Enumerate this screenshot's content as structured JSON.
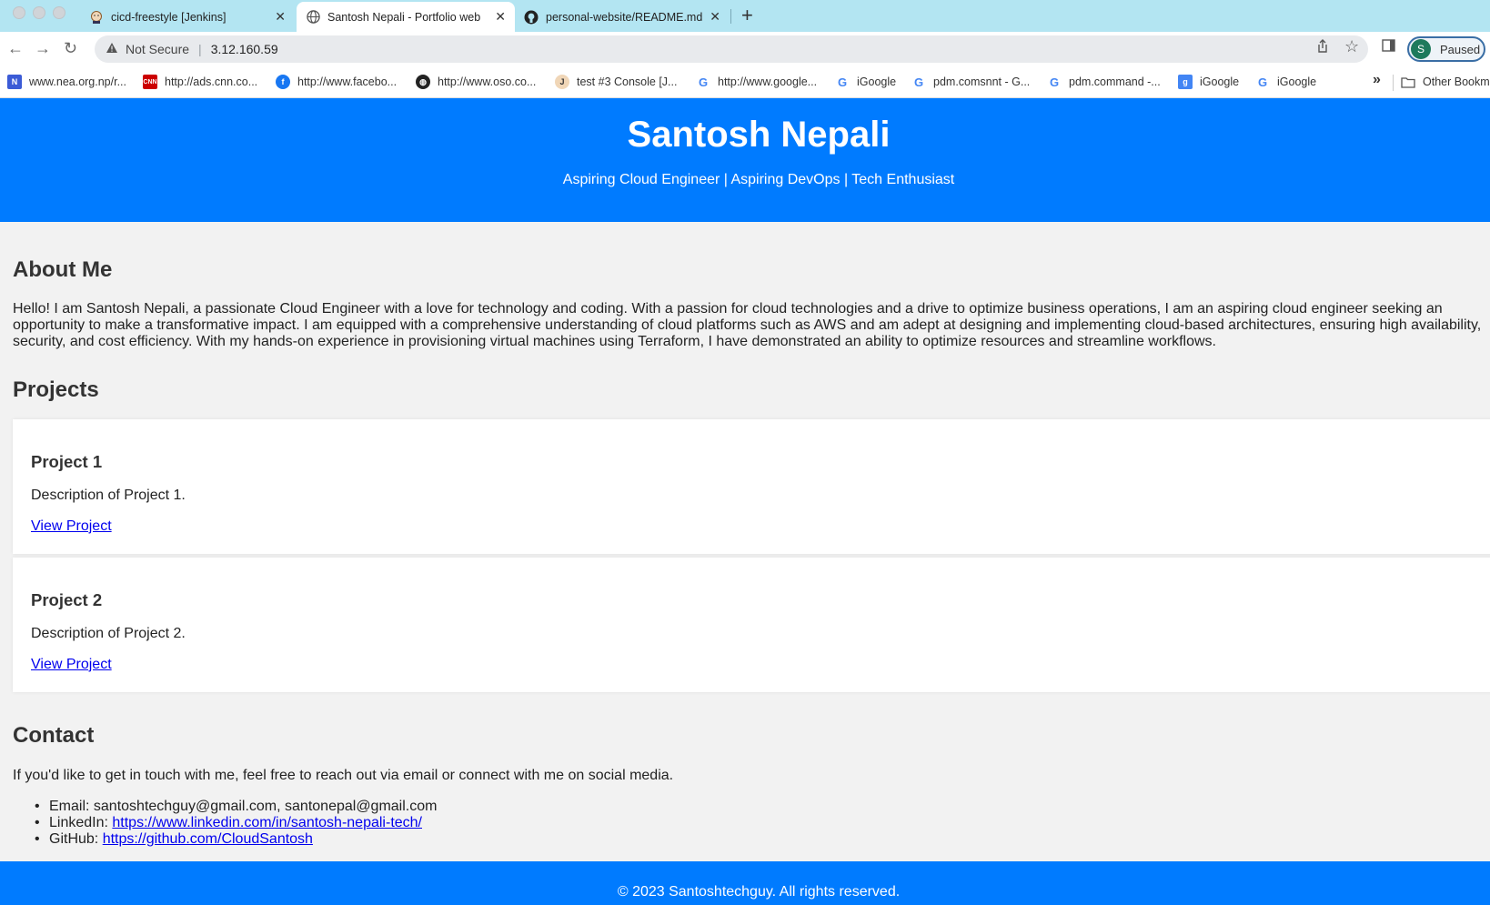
{
  "browser": {
    "tabs": [
      {
        "title": "cicd-freestyle [Jenkins]",
        "active": false,
        "icon": "jenkins-icon"
      },
      {
        "title": "Santosh Nepali - Portfolio web",
        "active": true,
        "icon": "globe-icon"
      },
      {
        "title": "personal-website/README.md",
        "active": false,
        "icon": "github-icon"
      }
    ],
    "new_tab_label": "+",
    "address": {
      "security_label": "Not Secure",
      "url": "3.12.160.59"
    },
    "profile": {
      "initial": "S",
      "label": "Paused"
    },
    "bookmarks": [
      {
        "label": "www.nea.org.np/r...",
        "icon": "nea-icon"
      },
      {
        "label": "http://ads.cnn.co...",
        "icon": "cnn-icon"
      },
      {
        "label": "http://www.facebo...",
        "icon": "facebook-icon"
      },
      {
        "label": "http://www.oso.co...",
        "icon": "globe-icon"
      },
      {
        "label": "test #3 Console [J...",
        "icon": "jenkins-icon"
      },
      {
        "label": "http://www.google...",
        "icon": "google-icon"
      },
      {
        "label": "iGoogle",
        "icon": "google-icon"
      },
      {
        "label": "pdm.comsnnt - G...",
        "icon": "google-icon"
      },
      {
        "label": "pdm.command -...",
        "icon": "google-icon"
      },
      {
        "label": "iGoogle",
        "icon": "igoogle-icon"
      },
      {
        "label": "iGoogle",
        "icon": "google-icon"
      }
    ],
    "more_bookmarks": "»",
    "other_bookmarks": "Other Bookm"
  },
  "page": {
    "header": {
      "name": "Santosh Nepali",
      "tagline": "Aspiring Cloud Engineer | Aspiring DevOps | Tech Enthusiast"
    },
    "about": {
      "heading": "About Me",
      "text": "Hello! I am Santosh Nepali, a passionate Cloud Engineer with a love for technology and coding. With a passion for cloud technologies and a drive to optimize business operations, I am an aspiring cloud engineer seeking an opportunity to make a transformative impact. I am equipped with a comprehensive understanding of cloud platforms such as AWS and am adept at designing and implementing cloud-based architectures, ensuring high availability, security, and cost efficiency. With my hands-on experience in provisioning virtual machines using Terraform, I have demonstrated an ability to optimize resources and streamline workflows."
    },
    "projects": {
      "heading": "Projects",
      "items": [
        {
          "title": "Project 1",
          "description": "Description of Project 1.",
          "link": "View Project"
        },
        {
          "title": "Project 2",
          "description": "Description of Project 2.",
          "link": "View Project"
        }
      ]
    },
    "contact": {
      "heading": "Contact",
      "intro": "If you'd like to get in touch with me, feel free to reach out via email or connect with me on social media.",
      "email_label": "Email:",
      "email_value": "santoshtechguy@gmail.com, santonepal@gmail.com",
      "linkedin_label": "LinkedIn:",
      "linkedin_url": "https://www.linkedin.com/in/santosh-nepali-tech/",
      "github_label": "GitHub:",
      "github_url": "https://github.com/CloudSantosh"
    },
    "footer": "© 2023 Santoshtechguy. All rights reserved."
  },
  "colors": {
    "accent": "#007bff",
    "page_bg": "#f2f2f2",
    "tabbar_bg": "#b3e5f2",
    "link": "#0000ee"
  }
}
